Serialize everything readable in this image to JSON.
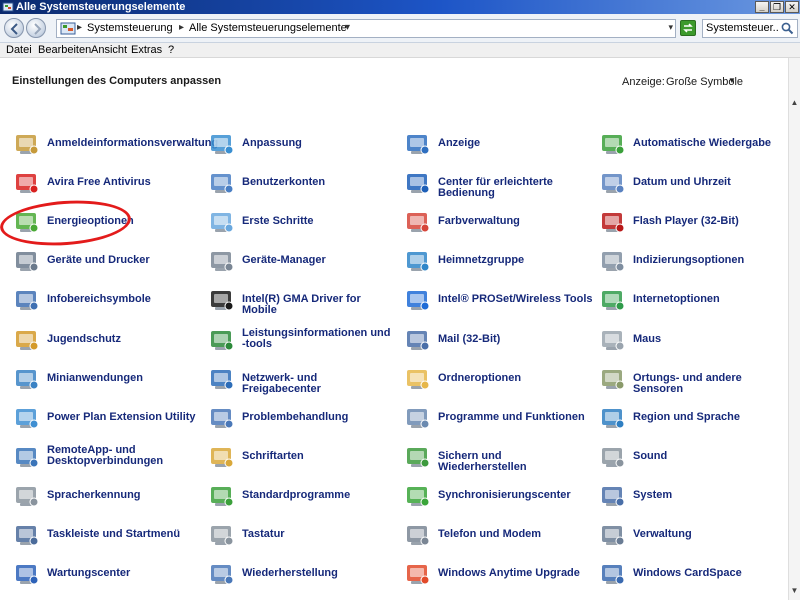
{
  "window": {
    "title": "Alle Systemsteuerungselemente",
    "buttons": {
      "minimize": "_",
      "maximize": "❐",
      "close": "✕"
    }
  },
  "address": {
    "crumbs": [
      "Systemsteuerung",
      "Alle Systemsteuerungselemente"
    ],
    "separator": "▸",
    "drop": "▾",
    "search_value": "Systemsteuer..."
  },
  "menu": [
    "Datei",
    "Bearbeiten",
    "Ansicht",
    "Extras",
    "?"
  ],
  "content": {
    "heading": "Einstellungen des Computers anpassen",
    "view_label": "Anzeige:",
    "view_value": "Große Symbole",
    "view_drop": "▼"
  },
  "scroll": {
    "up": "▲",
    "down": "▼"
  },
  "items": [
    {
      "label": "Anmeldeinformationsverwaltung",
      "icon": "vault-icon",
      "color": "#c69a3a"
    },
    {
      "label": "Anpassung",
      "icon": "personalize-icon",
      "color": "#3a8fd1"
    },
    {
      "label": "Anzeige",
      "icon": "display-icon",
      "color": "#2e6fc0"
    },
    {
      "label": "Automatische Wiedergabe",
      "icon": "autoplay-icon",
      "color": "#3aa03a"
    },
    {
      "label": "Avira Free Antivirus",
      "icon": "avira-icon",
      "color": "#d8201f"
    },
    {
      "label": "Benutzerkonten",
      "icon": "users-icon",
      "color": "#4a7fc4"
    },
    {
      "label": "Center für erleichterte Bedienung",
      "icon": "ease-of-access-icon",
      "color": "#1d5fb8"
    },
    {
      "label": "Datum und Uhrzeit",
      "icon": "calendar-clock-icon",
      "color": "#5a82c0"
    },
    {
      "label": "Energieoptionen",
      "icon": "battery-plug-icon",
      "color": "#49a935"
    },
    {
      "label": "Erste Schritte",
      "icon": "getting-started-icon",
      "color": "#6aa8de"
    },
    {
      "label": "Farbverwaltung",
      "icon": "color-management-icon",
      "color": "#d6453a"
    },
    {
      "label": "Flash Player (32-Bit)",
      "icon": "flash-icon",
      "color": "#b81818"
    },
    {
      "label": "Geräte und Drucker",
      "icon": "printer-icon",
      "color": "#6b7a8c"
    },
    {
      "label": "Geräte-Manager",
      "icon": "device-manager-icon",
      "color": "#7a8694"
    },
    {
      "label": "Heimnetzgruppe",
      "icon": "homegroup-icon",
      "color": "#2f86c9"
    },
    {
      "label": "Indizierungsoptionen",
      "icon": "magnifier-icon",
      "color": "#7f8ea0"
    },
    {
      "label": "Infobereichsymbole",
      "icon": "tray-icon",
      "color": "#3e6fb2"
    },
    {
      "label": "Intel(R) GMA Driver for Mobile",
      "icon": "intel-gma-icon",
      "color": "#1a1a1a"
    },
    {
      "label": "Intel® PROSet/Wireless Tools",
      "icon": "wireless-icon",
      "color": "#1e6bd6"
    },
    {
      "label": "Internetoptionen",
      "icon": "globe-icon",
      "color": "#2f9b4a"
    },
    {
      "label": "Jugendschutz",
      "icon": "parental-controls-icon",
      "color": "#d49a2a"
    },
    {
      "label": "Leistungsinformationen und -tools",
      "icon": "performance-icon",
      "color": "#2c8a3a"
    },
    {
      "label": "Mail (32-Bit)",
      "icon": "mail-icon",
      "color": "#4a6fa8"
    },
    {
      "label": "Maus",
      "icon": "mouse-icon",
      "color": "#9aa4ae"
    },
    {
      "label": "Minianwendungen",
      "icon": "gadgets-icon",
      "color": "#3a82c4"
    },
    {
      "label": "Netzwerk- und Freigabecenter",
      "icon": "network-icon",
      "color": "#2d6db8"
    },
    {
      "label": "Ordneroptionen",
      "icon": "folder-icon",
      "color": "#e6b74a"
    },
    {
      "label": "Ortungs- und andere Sensoren",
      "icon": "sensor-icon",
      "color": "#8a9a6a"
    },
    {
      "label": "Power Plan Extension Utility",
      "icon": "power-plan-icon",
      "color": "#3f8fd2"
    },
    {
      "label": "Problembehandlung",
      "icon": "troubleshoot-icon",
      "color": "#4a78b8"
    },
    {
      "label": "Programme und Funktionen",
      "icon": "programs-icon",
      "color": "#6b8ab0"
    },
    {
      "label": "Region und Sprache",
      "icon": "region-globe-icon",
      "color": "#2f7fc2"
    },
    {
      "label": "RemoteApp- und Desktopverbindungen",
      "icon": "remote-desktop-icon",
      "color": "#3a74b8"
    },
    {
      "label": "Schriftarten",
      "icon": "fonts-icon",
      "color": "#d9a83a"
    },
    {
      "label": "Sichern und Wiederherstellen",
      "icon": "backup-icon",
      "color": "#3d9a3d"
    },
    {
      "label": "Sound",
      "icon": "speaker-icon",
      "color": "#8a949e"
    },
    {
      "label": "Spracherkennung",
      "icon": "microphone-icon",
      "color": "#8a949e"
    },
    {
      "label": "Standardprogramme",
      "icon": "default-programs-icon",
      "color": "#3ba03b"
    },
    {
      "label": "Synchronisierungscenter",
      "icon": "sync-icon",
      "color": "#3aa53a"
    },
    {
      "label": "System",
      "icon": "system-icon",
      "color": "#4a6fa8"
    },
    {
      "label": "Taskleiste und Startmenü",
      "icon": "taskbar-icon",
      "color": "#4b6b9a"
    },
    {
      "label": "Tastatur",
      "icon": "keyboard-icon",
      "color": "#8a949e"
    },
    {
      "label": "Telefon und Modem",
      "icon": "phone-modem-icon",
      "color": "#7a8694"
    },
    {
      "label": "Verwaltung",
      "icon": "admin-tools-icon",
      "color": "#6a7c94"
    },
    {
      "label": "Wartungscenter",
      "icon": "flag-icon",
      "color": "#2d62b8"
    },
    {
      "label": "Wiederherstellung",
      "icon": "recovery-icon",
      "color": "#4a78b8"
    },
    {
      "label": "Windows Anytime Upgrade",
      "icon": "windows-logo-icon",
      "color": "#e24a2a"
    },
    {
      "label": "Windows CardSpace",
      "icon": "cardspace-icon",
      "color": "#3a6ab0"
    }
  ]
}
